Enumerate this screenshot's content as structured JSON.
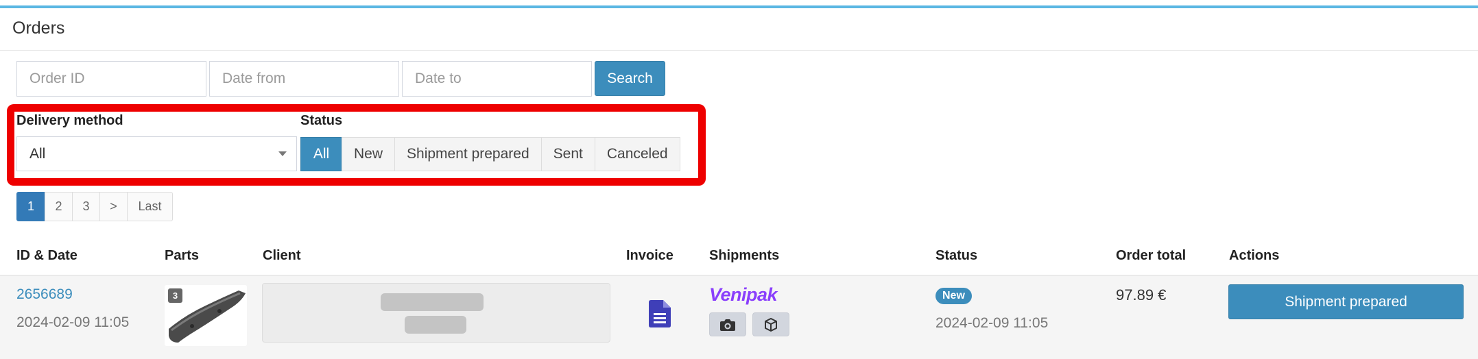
{
  "page": {
    "title": "Orders"
  },
  "filters": {
    "order_id_placeholder": "Order ID",
    "date_from_placeholder": "Date from",
    "date_to_placeholder": "Date to",
    "search_label": "Search",
    "delivery_method": {
      "label": "Delivery method",
      "selected": "All"
    },
    "status": {
      "label": "Status",
      "options": [
        "All",
        "New",
        "Shipment prepared",
        "Sent",
        "Canceled"
      ],
      "active": "All"
    }
  },
  "pagination": {
    "pages": [
      "1",
      "2",
      "3",
      ">",
      "Last"
    ],
    "current": "1"
  },
  "table": {
    "headers": [
      "ID & Date",
      "Parts",
      "Client",
      "Invoice",
      "Shipments",
      "Status",
      "Order total",
      "Actions"
    ],
    "rows": [
      {
        "id": "2656689",
        "date": "2024-02-09 11:05",
        "parts_count": "3",
        "carrier": "Venipak",
        "status_badge": "New",
        "status_date": "2024-02-09 11:05",
        "total": "97.89 €",
        "action_label": "Shipment prepared"
      }
    ]
  },
  "icons": [
    "chevron-down-icon",
    "invoice-document-icon",
    "camera-icon",
    "package-icon"
  ],
  "colors": {
    "primary": "#3c8dbc",
    "top_accent": "#5bb7e3",
    "highlight": "#ee0000",
    "venipak": "#8a3ffc",
    "invoice_icon": "#3f3fb8"
  }
}
